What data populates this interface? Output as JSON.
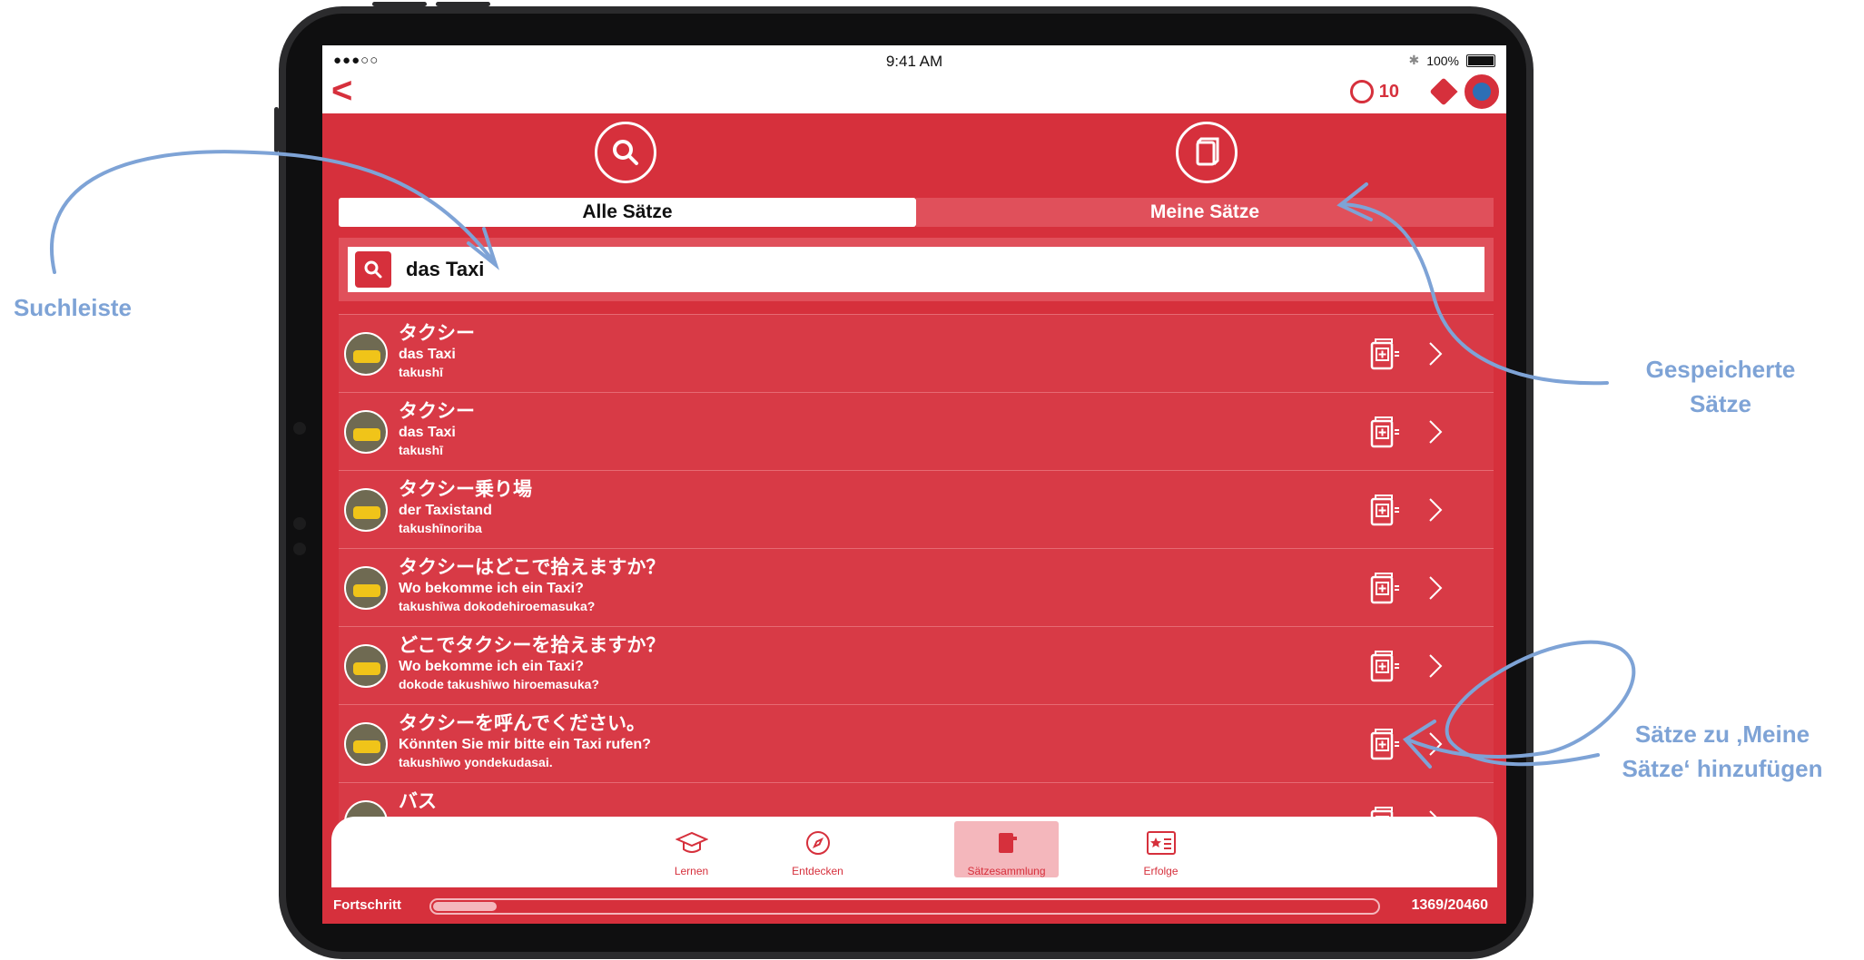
{
  "status_bar": {
    "signal": "●●●○○",
    "time": "9:41 AM",
    "battery": "100%"
  },
  "header": {
    "back_label": "<",
    "coins": "10"
  },
  "segments": {
    "all": "Alle Sätze",
    "mine": "Meine Sätze"
  },
  "search": {
    "value": "das Taxi"
  },
  "phrases": [
    {
      "jp": "タクシー",
      "de": "das Taxi",
      "rom": "takushī"
    },
    {
      "jp": "タクシー",
      "de": "das Taxi",
      "rom": "takushī"
    },
    {
      "jp": "タクシー乗り場",
      "de": "der Taxistand",
      "rom": "takushīnoriba"
    },
    {
      "jp": "タクシーはどこで拾えますか？",
      "de": "Wo bekomme ich ein Taxi?",
      "rom": "takushīwa dokodehiroemasuka?"
    },
    {
      "jp": "どこでタクシーを拾えますか？",
      "de": "Wo bekomme ich ein Taxi?",
      "rom": "dokode takushīwo hiroemasuka?"
    },
    {
      "jp": "タクシーを呼んでください。",
      "de": "Könnten Sie mir bitte ein Taxi rufen?",
      "rom": "takushīwo yondekudasai."
    },
    {
      "jp": "バス",
      "de": "",
      "rom": ""
    }
  ],
  "tabs": [
    {
      "label": "Lernen",
      "icon": "graduation-cap-icon"
    },
    {
      "label": "Entdecken",
      "icon": "compass-icon"
    },
    {
      "label": "Sätzesammlung",
      "icon": "phrase-book-icon",
      "selected": true
    },
    {
      "label": "Erfolge",
      "icon": "star-card-icon"
    }
  ],
  "progress": {
    "label": "Fortschritt",
    "count": "1369/20460",
    "fraction": 0.067
  },
  "annotations": {
    "search_bar": "Suchleiste",
    "saved": "Gespeicherte Sätze",
    "add": "Sätze zu ‚Meine Sätze‘ hinzufügen"
  },
  "colors": {
    "brand_red": "#d6303c",
    "annotation_blue": "#7ea3d6"
  }
}
